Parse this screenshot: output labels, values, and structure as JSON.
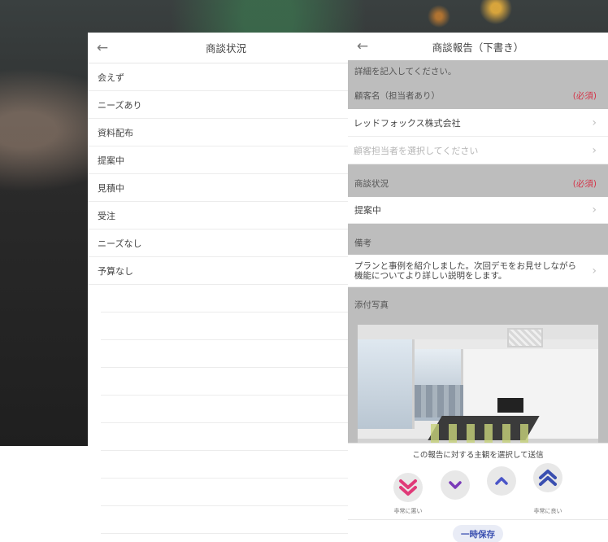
{
  "left_screen": {
    "back_icon": "arrow-left-icon",
    "title": "商談状況",
    "options": [
      "会えず",
      "ニーズあり",
      "資料配布",
      "提案中",
      "見積中",
      "受注",
      "ニーズなし",
      "予算なし"
    ]
  },
  "right_screen": {
    "back_icon": "arrow-left-icon",
    "title": "商談報告（下書き）",
    "instruction": "詳細を記入してください。",
    "customer_section": {
      "label": "顧客名（担当者あり）",
      "required": "(必須)"
    },
    "customer_name": "レッドフォックス株式会社",
    "contact_placeholder": "顧客担当者を選択してください",
    "status_section": {
      "label": "商談状況",
      "required": "(必須)"
    },
    "status_value": "提案中",
    "notes_section": {
      "label": "備考"
    },
    "notes_value": "プランと事例を紹介しました。次回デモをお見せしながら機能についてより詳しい説明をします。",
    "photo_section": {
      "label": "添付写真"
    },
    "feedback": {
      "title": "この報告に対する主観を選択して送信",
      "very_bad_label": "非常に悪い",
      "very_good_label": "非常に良い",
      "icons": [
        "double-chevron-down-icon",
        "chevron-down-icon",
        "chevron-up-icon",
        "double-chevron-up-icon"
      ],
      "colors": {
        "very_bad": "#e03a78",
        "bad": "#7a3ab8",
        "good": "#4a55c8",
        "very_good": "#3a4fb0"
      }
    },
    "save_button": "一時保存"
  }
}
